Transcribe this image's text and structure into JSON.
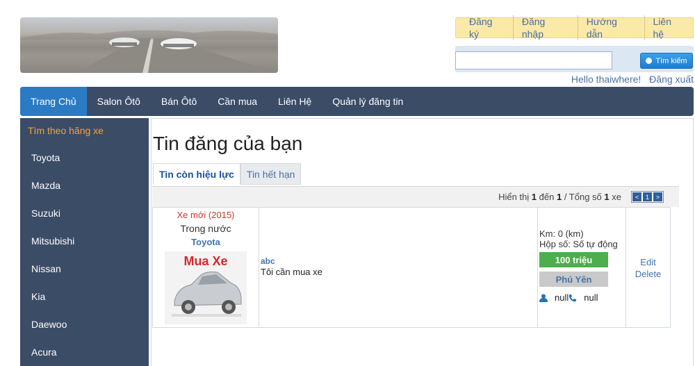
{
  "top_links": [
    "Đăng ký",
    "Đăng nhập",
    "Hướng dẫn",
    "Liên hệ"
  ],
  "search": {
    "placeholder": "",
    "button_label": "Tìm kiếm"
  },
  "user": {
    "greeting": "Hello thaiwhere!",
    "logout": "Đăng xuất"
  },
  "nav": [
    "Trang Chủ",
    "Salon Ôtô",
    "Bán Ôtô",
    "Cần mua",
    "Liên Hệ",
    "Quản lý đăng tin"
  ],
  "sidebar": {
    "title": "Tìm theo hãng xe",
    "items": [
      "Toyota",
      "Mazda",
      "Suzuki",
      "Mitsubishi",
      "Nissan",
      "Kia",
      "Daewoo",
      "Acura"
    ]
  },
  "main": {
    "title": "Tin đăng của bạn",
    "tabs": [
      "Tin còn hiệu lực",
      "Tin hết hạn"
    ],
    "pager": {
      "prefix": "Hiển thị",
      "from": "1",
      "to_label": "đến",
      "to": "1",
      "total_label": "/ Tổng số",
      "total": "1",
      "unit": "xe",
      "prev": "<",
      "page": "1",
      "next": ">"
    }
  },
  "listing": {
    "condition": "Xe mới (2015)",
    "origin": "Trong nước",
    "brand": "Toyota",
    "image_text": "Mua Xe",
    "title": "abc",
    "description": "Tôi cần mua xe",
    "km": "Km: 0 (km)",
    "gearbox": "Hộp số: Số tự động",
    "price": "100 triệu",
    "location": "Phú Yên",
    "contact_name": "null",
    "contact_phone": "null",
    "edit": "Edit",
    "delete": "Delete"
  }
}
